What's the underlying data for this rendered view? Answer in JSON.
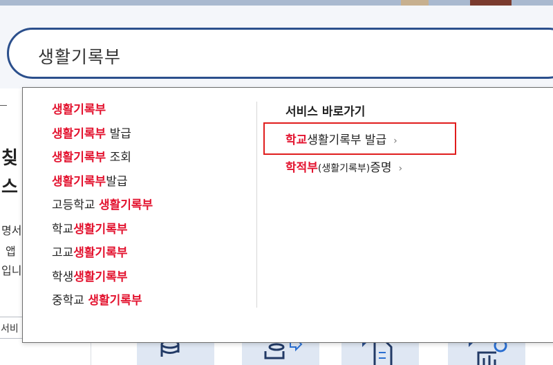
{
  "search": {
    "query": "생활기록부"
  },
  "suggestions": [
    {
      "pre": "",
      "hl": "생활기록부",
      "post": ""
    },
    {
      "pre": "",
      "hl": "생활기록부",
      "post": " 발급"
    },
    {
      "pre": "",
      "hl": "생활기록부",
      "post": " 조회"
    },
    {
      "pre": "",
      "hl": "생활기록부",
      "post": "발급"
    },
    {
      "pre": "고등학교 ",
      "hl": "생활기록부",
      "post": ""
    },
    {
      "pre": "학교",
      "hl": "생활기록부",
      "post": ""
    },
    {
      "pre": "고교",
      "hl": "생활기록부",
      "post": ""
    },
    {
      "pre": "학생",
      "hl": "생활기록부",
      "post": ""
    },
    {
      "pre": "중학교 ",
      "hl": "생활기록부",
      "post": ""
    }
  ],
  "services": {
    "title": "서비스 바로가기",
    "links": [
      {
        "hl": "학교",
        "rest": "생활기록부 발급",
        "chev": "›"
      },
      {
        "hl": "학적부",
        "rest": "(생활기록부)",
        "rest2": "증명",
        "chev": "›"
      }
    ]
  },
  "background": {
    "title1": "칮",
    "title2": "스",
    "lines": [
      "명서",
      "앱",
      "입니"
    ],
    "button": "서비"
  },
  "colors": {
    "highlight": "#e3132f",
    "search_border": "#2b4f8c",
    "focus_box": "#e01c1c"
  }
}
